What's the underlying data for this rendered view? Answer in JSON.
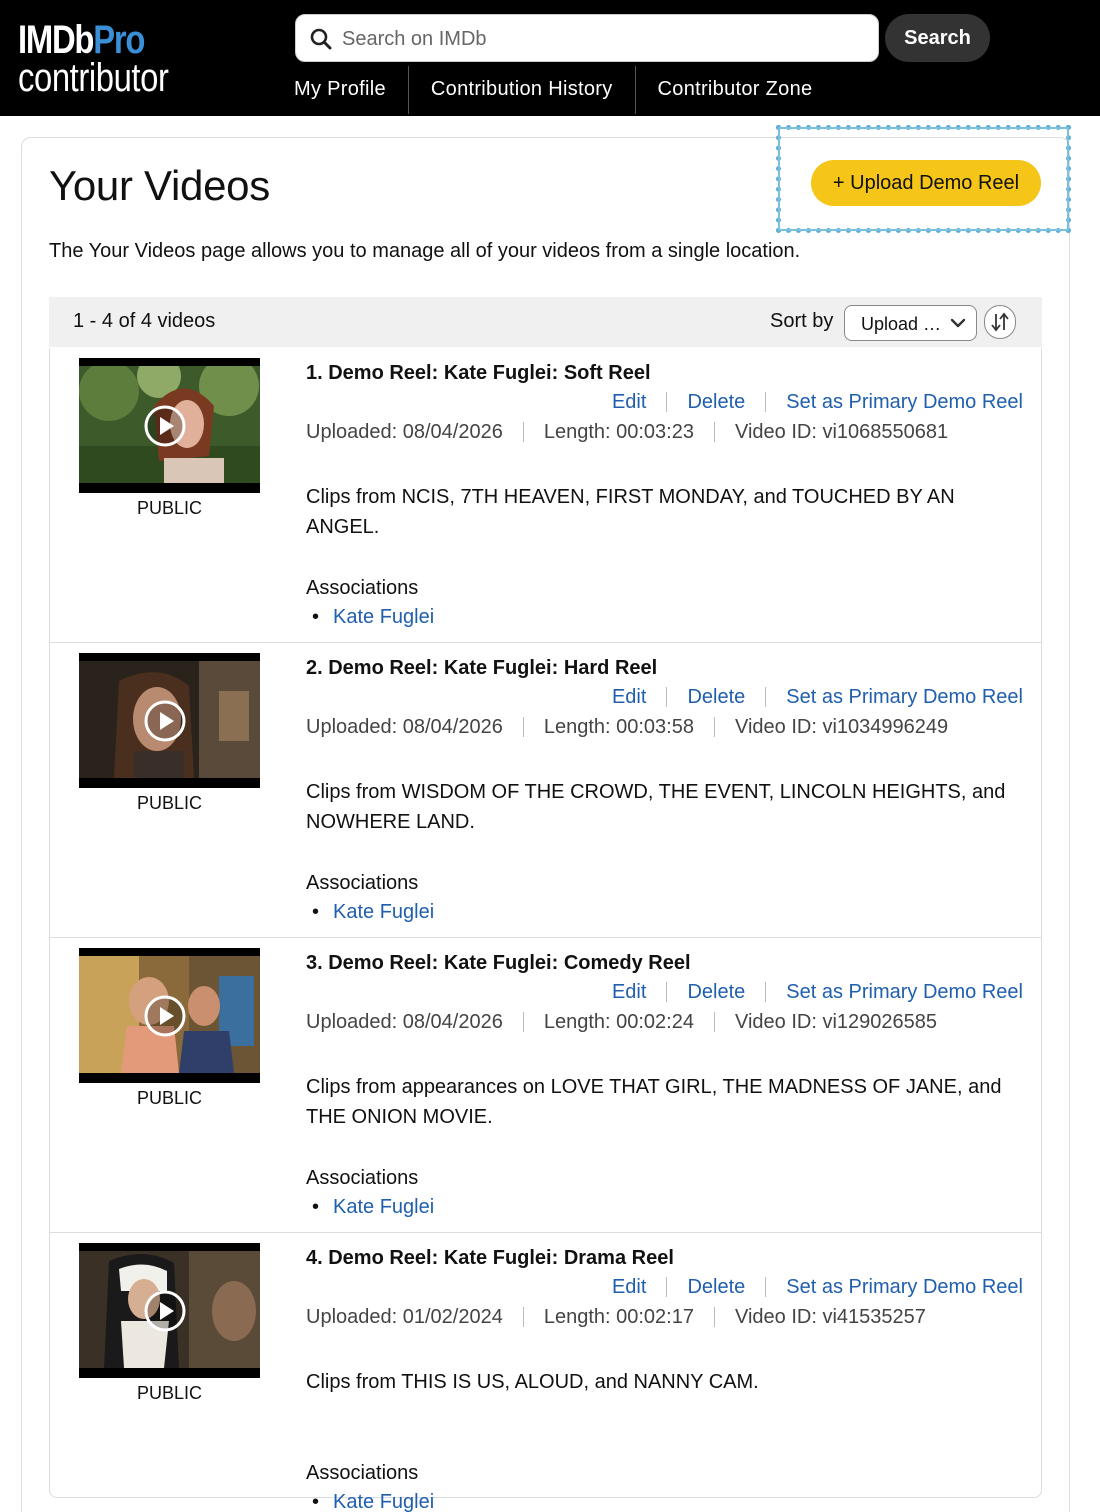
{
  "header": {
    "logo_line1": "IMDb",
    "logo_line1_accent": "Pro",
    "logo_line2": "contributor",
    "search_placeholder": "Search on IMDb",
    "search_button": "Search",
    "nav": [
      "My Profile",
      "Contribution History",
      "Contributor Zone"
    ]
  },
  "page": {
    "title": "Your Videos",
    "upload_button": "+ Upload Demo Reel",
    "intro": "The Your Videos page allows you to manage all of your videos from a single location."
  },
  "list": {
    "count": "1 - 4 of 4 videos",
    "sort_label": "Sort by",
    "sort_value": "Upload …"
  },
  "actions": {
    "edit": "Edit",
    "delete": "Delete",
    "primary": "Set as Primary Demo Reel"
  },
  "videos": [
    {
      "title": "1. Demo Reel: Kate Fuglei: Soft Reel",
      "uploaded": "Uploaded: 08/04/2026",
      "length": "Length: 00:03:23",
      "video_id": "Video ID: vi1068550681",
      "description": "Clips from NCIS, 7TH HEAVEN, FIRST MONDAY, and TOUCHED BY AN ANGEL.",
      "visibility": "PUBLIC",
      "associations_label": "Associations",
      "association": "Kate Fuglei"
    },
    {
      "title": "2. Demo Reel: Kate Fuglei: Hard Reel",
      "uploaded": "Uploaded: 08/04/2026",
      "length": "Length: 00:03:58",
      "video_id": "Video ID: vi1034996249",
      "description": "Clips from WISDOM OF THE CROWD, THE EVENT, LINCOLN HEIGHTS, and NOWHERE LAND.",
      "visibility": "PUBLIC",
      "associations_label": "Associations",
      "association": "Kate Fuglei"
    },
    {
      "title": "3. Demo Reel: Kate Fuglei: Comedy Reel",
      "uploaded": "Uploaded: 08/04/2026",
      "length": "Length: 00:02:24",
      "video_id": "Video ID: vi129026585",
      "description": "Clips from appearances on LOVE THAT GIRL, THE MADNESS OF JANE, and THE ONION MOVIE.",
      "visibility": "PUBLIC",
      "associations_label": "Associations",
      "association": "Kate Fuglei"
    },
    {
      "title": "4. Demo Reel: Kate Fuglei: Drama Reel",
      "uploaded": "Uploaded: 01/02/2024",
      "length": "Length: 00:02:17",
      "video_id": "Video ID: vi41535257",
      "description": "Clips from THIS IS US, ALOUD, and NANNY CAM.",
      "visibility": "PUBLIC",
      "associations_label": "Associations",
      "association": "Kate Fuglei"
    }
  ],
  "colors": {
    "header_bg": "#000000",
    "accent_yellow": "#f5c518",
    "link_blue": "#1f5fae",
    "logo_pro_blue": "#3a8fd6",
    "highlight_blue": "#5aaed6"
  }
}
